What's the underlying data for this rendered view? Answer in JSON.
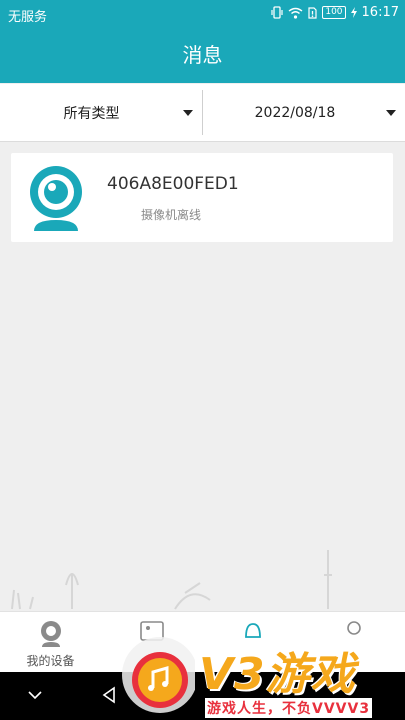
{
  "status_bar": {
    "carrier": "无服务",
    "battery": "100",
    "time": "16:17"
  },
  "header": {
    "title": "消息"
  },
  "filters": {
    "type_label": "所有类型",
    "date_label": "2022/08/18"
  },
  "messages": [
    {
      "device_id": "406A8E00FED1",
      "text": "摄像机离线",
      "icon": "camera-icon"
    }
  ],
  "tabs": [
    {
      "label": "我的设备",
      "icon": "webcam-icon"
    },
    {
      "label": "",
      "icon": "image-icon"
    },
    {
      "label": "",
      "icon": "bell-icon"
    },
    {
      "label": "",
      "icon": "user-icon"
    }
  ],
  "watermark": {
    "brand": "V3游戏",
    "slogan": "游戏人生，不负VVVV3"
  },
  "colors": {
    "primary": "#1aa8b9",
    "background": "#efefef",
    "watermark_orange": "#f5a81c",
    "watermark_red": "#e8303d"
  }
}
